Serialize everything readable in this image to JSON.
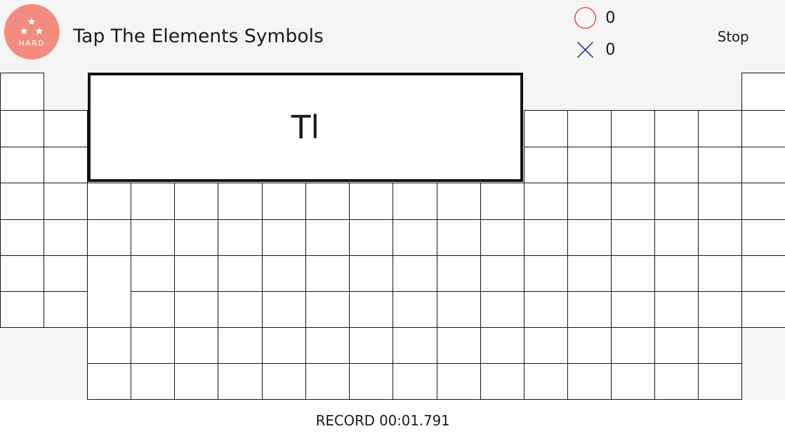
{
  "header": {
    "difficulty_badge": {
      "stars": 3,
      "icon": "star-icon",
      "label": "HARD",
      "color": "#f18c7e"
    },
    "title": "Tap The Elements Symbols",
    "stop_label": "Stop"
  },
  "scores": {
    "correct": {
      "icon": "circle-icon",
      "value": "0",
      "color": "#e05a48"
    },
    "wrong": {
      "icon": "cross-icon",
      "value": "0",
      "color": "#2b3a9e"
    }
  },
  "prompt": {
    "symbol": "Tl"
  },
  "periodic_table": {
    "main_rows": 7,
    "main_groups": 18,
    "f_block_rows": 2,
    "f_block_columns": 15
  },
  "footer": {
    "record_text": "RECORD 00:01.791"
  }
}
